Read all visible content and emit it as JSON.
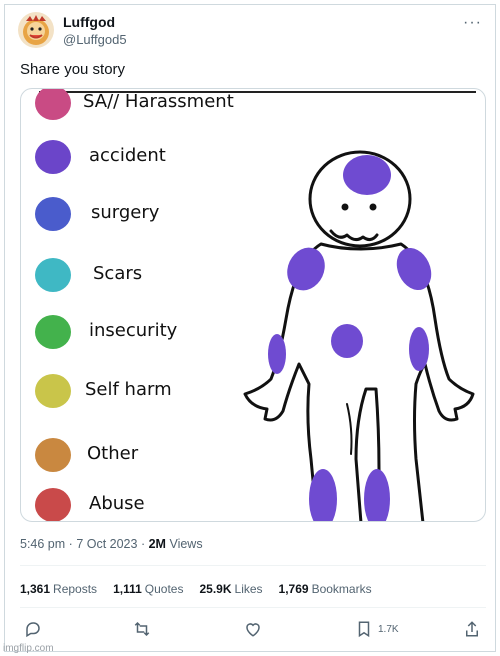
{
  "author": {
    "name": "Luffgod",
    "handle": "@Luffgod5",
    "avatar_icon": "cartoon-avatar-icon"
  },
  "tweet": {
    "text": "Share you story",
    "media": {
      "legend": [
        {
          "label": "SA// Harassment",
          "color": "#c94b84"
        },
        {
          "label": "accident",
          "color": "#6b45c9"
        },
        {
          "label": "surgery",
          "color": "#4a5ccc"
        },
        {
          "label": "Scars",
          "color": "#3fb8c4"
        },
        {
          "label": "insecurity",
          "color": "#43b24c"
        },
        {
          "label": "Self harm",
          "color": "#c9c54a"
        },
        {
          "label": "Other",
          "color": "#c98840"
        },
        {
          "label": "Abuse",
          "color": "#c94a4a"
        }
      ],
      "figure_mark_color": "#6f4bd1"
    }
  },
  "meta": {
    "time": "5:46 pm",
    "separator": "·",
    "date": "7 Oct 2023",
    "views_count": "2M",
    "views_label": "Views"
  },
  "stats": [
    {
      "count": "1,361",
      "label": "Reposts"
    },
    {
      "count": "1,111",
      "label": "Quotes"
    },
    {
      "count": "25.9K",
      "label": "Likes"
    },
    {
      "count": "1,769",
      "label": "Bookmarks"
    }
  ],
  "actions": {
    "bookmark_count": "1.7K",
    "icons": [
      "reply-icon",
      "repost-icon",
      "like-icon",
      "bookmark-icon",
      "share-icon"
    ]
  },
  "watermark": "imgflip.com"
}
